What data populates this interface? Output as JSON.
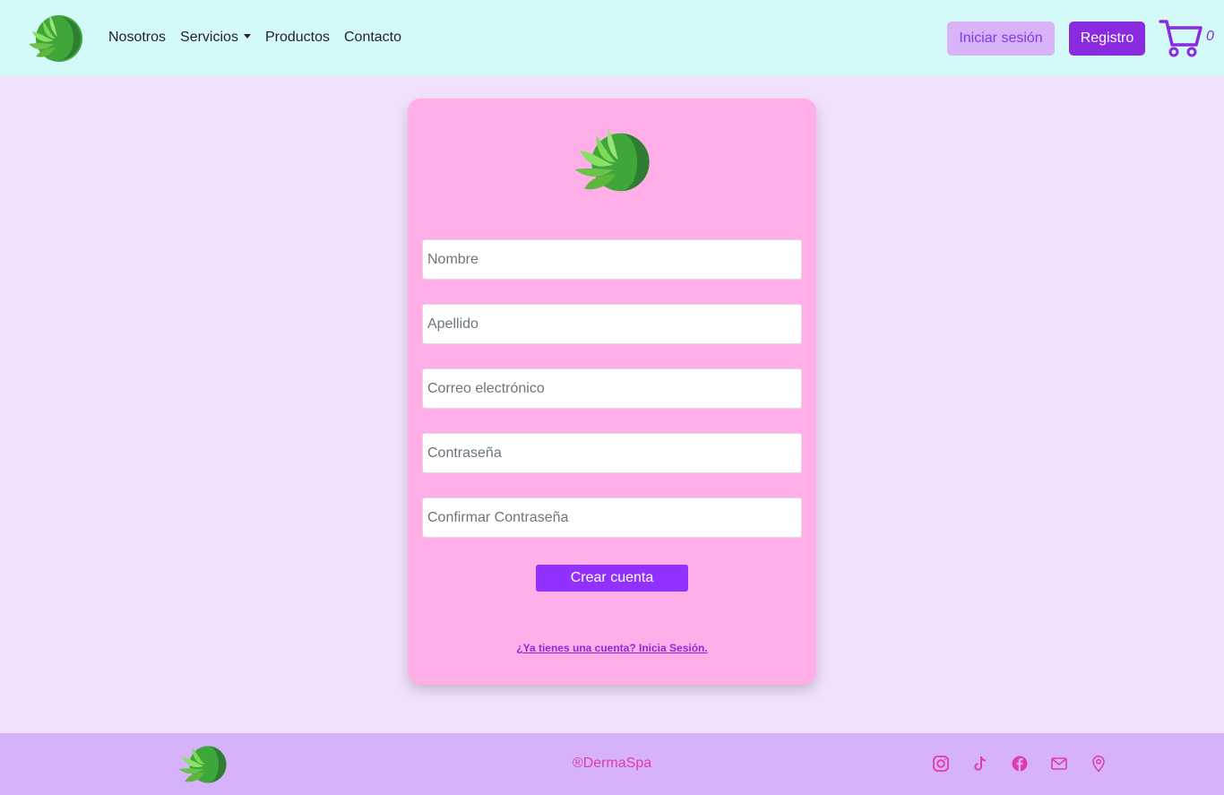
{
  "nav": {
    "links": [
      "Nosotros",
      "Servicios",
      "Productos",
      "Contacto"
    ],
    "login_label": "Iniciar sesión",
    "register_label": "Registro",
    "cart_count": "0"
  },
  "form": {
    "placeholders": {
      "first_name": "Nombre",
      "last_name": "Apellido",
      "email": "Correo electrónico",
      "password": "Contraseña",
      "confirm_password": "Confirmar Contraseña"
    },
    "submit_label": "Crear cuenta",
    "login_link": "¿Ya tienes una cuenta? Inicia Sesión."
  },
  "footer": {
    "copyright": "®DermaSpa",
    "social_icons": [
      "instagram-icon",
      "tiktok-icon",
      "facebook-icon",
      "mail-icon",
      "location-icon"
    ]
  },
  "colors": {
    "nav_bg": "#d3f9f9",
    "page_bg": "#f2e1fc",
    "card_bg": "#ffaee7",
    "accent": "#8a2be2",
    "footer_bg": "#d6b2fb",
    "footer_accent": "#e23ba7"
  }
}
